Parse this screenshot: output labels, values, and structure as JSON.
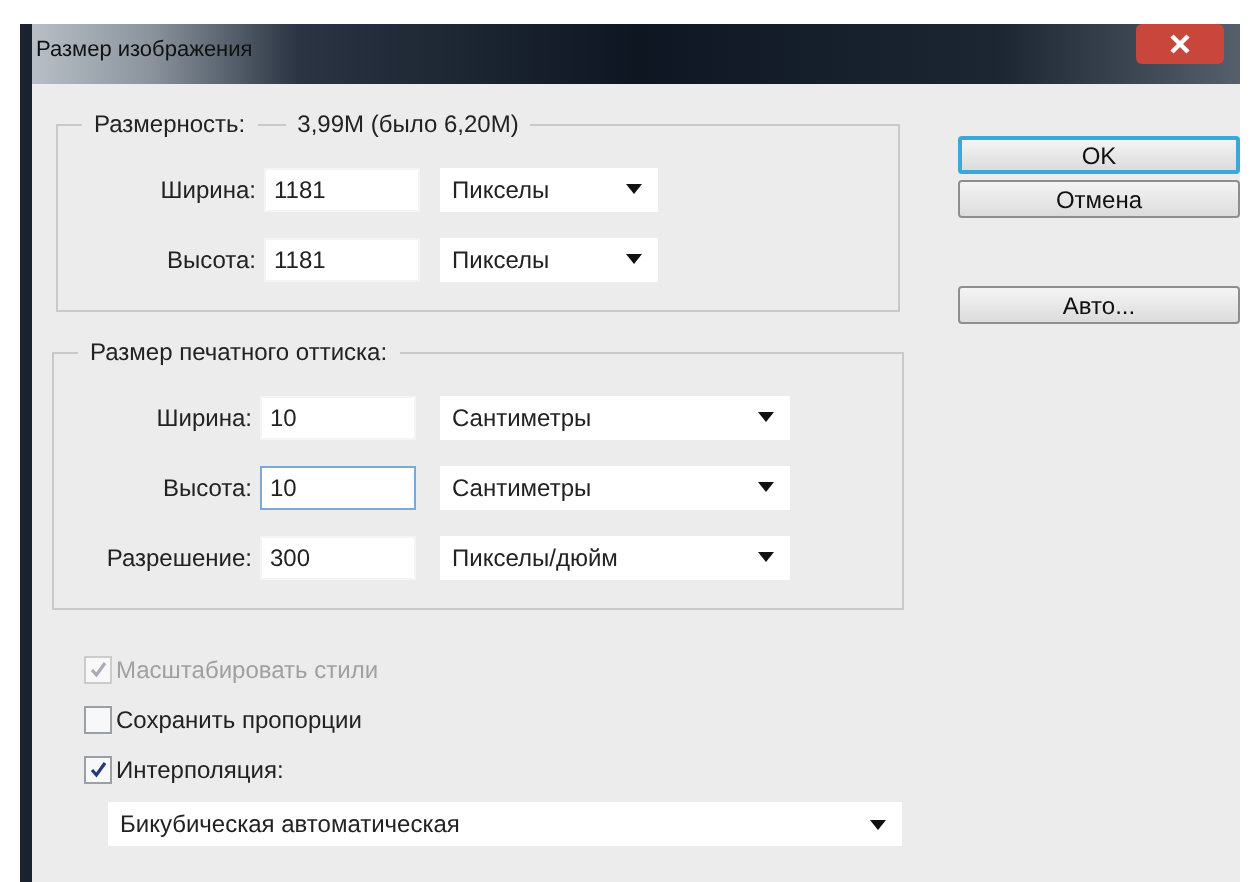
{
  "window": {
    "title": "Размер изображения"
  },
  "pixel_dimensions": {
    "label": "Размерность:",
    "value": "3,99М (было 6,20М)",
    "rows": [
      {
        "label": "Ширина:",
        "value": "1181",
        "unit": "Пикселы",
        "focused": false
      },
      {
        "label": "Высота:",
        "value": "1181",
        "unit": "Пикселы",
        "focused": false
      }
    ]
  },
  "document_size": {
    "label": "Размер печатного оттиска:",
    "rows": [
      {
        "label": "Ширина:",
        "value": "10",
        "unit": "Сантиметры",
        "focused": false
      },
      {
        "label": "Высота:",
        "value": "10",
        "unit": "Сантиметры",
        "focused": true
      },
      {
        "label": "Разрешение:",
        "value": "300",
        "unit": "Пикселы/дюйм",
        "focused": false
      }
    ]
  },
  "options": [
    {
      "label": "Масштабировать стили",
      "checked": true,
      "disabled": true
    },
    {
      "label": "Сохранить пропорции",
      "checked": false,
      "disabled": false
    },
    {
      "label": "Интерполяция:",
      "checked": true,
      "disabled": false
    }
  ],
  "interpolation_method": "Бикубическая автоматическая",
  "buttons": [
    {
      "label": "OK",
      "default": true
    },
    {
      "label": "Отмена",
      "default": false
    },
    {
      "label": "Авто...",
      "default": false
    }
  ]
}
